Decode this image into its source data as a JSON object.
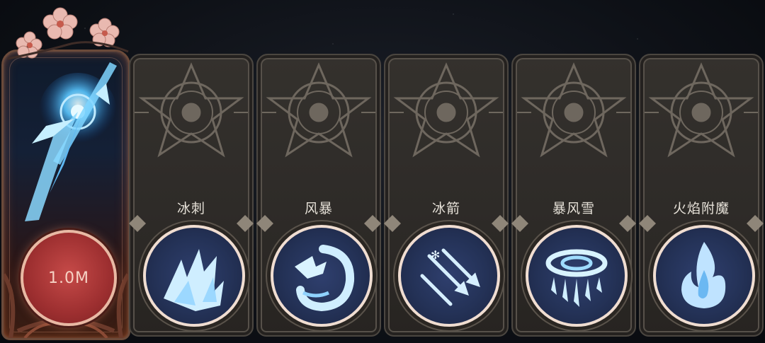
{
  "featured_skill": {
    "cost": "1.0M",
    "icon": "ice-shard-burst-icon"
  },
  "skills": [
    {
      "name": "冰刺",
      "icon": "ice-spikes-icon"
    },
    {
      "name": "风暴",
      "icon": "storm-dragon-icon"
    },
    {
      "name": "冰箭",
      "icon": "ice-arrows-icon"
    },
    {
      "name": "暴风雪",
      "icon": "blizzard-icon"
    },
    {
      "name": "火焰附魔",
      "icon": "flame-enchant-icon"
    }
  ],
  "colors": {
    "card_bg": "#302d2a",
    "card_border": "#57514a",
    "slot_bg": "#243257",
    "slot_ring": "#f0ddd1",
    "cost_red": "#9d2f30",
    "ice_glow": "#bfe3ff"
  }
}
